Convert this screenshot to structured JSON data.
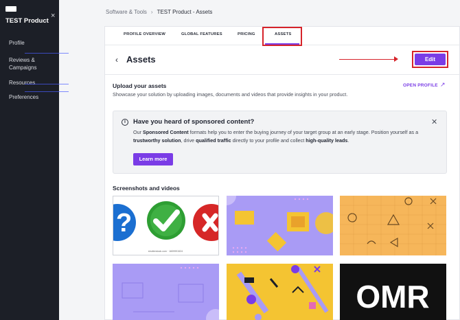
{
  "sidebar": {
    "product_name": "TEST Product",
    "items": [
      {
        "label": "Profile"
      },
      {
        "label": "Reviews & Campaigns"
      },
      {
        "label": "Resources"
      },
      {
        "label": "Preferences"
      }
    ]
  },
  "breadcrumb": {
    "parent": "Software & Tools",
    "separator": "›",
    "current": "TEST Product - Assets"
  },
  "tabs": [
    {
      "label": "PROFILE OVERVIEW"
    },
    {
      "label": "GLOBAL FEATURES"
    },
    {
      "label": "PRICING"
    },
    {
      "label": "ASSETS",
      "active": true
    }
  ],
  "header": {
    "back_icon": "‹",
    "title": "Assets",
    "edit_label": "Edit"
  },
  "upload": {
    "title": "Upload your assets",
    "description": "Showcase your solution by uploading images, documents and videos that provide insights in your product.",
    "open_profile_label": "OPEN PROFILE",
    "open_profile_icon": "↗"
  },
  "info_box": {
    "icon": "i",
    "title": "Have you heard of sponsored content?",
    "text_parts": {
      "p1": "Our ",
      "b1": "Sponsored Content",
      "p2": " formats help you to enter the buying journey of your target group at an early stage. Position yourself as a ",
      "b2": "trustworthy solution",
      "p3": ", drive ",
      "b3": "qualified traffic",
      "p4": " directly to your profile and collect ",
      "b4": "high-quality leads",
      "p5": "."
    },
    "button_label": "Learn more",
    "close_icon": "✕"
  },
  "media": {
    "title": "Screenshots and videos",
    "thumb1_caption": "shutterstock.com · 1609991524",
    "thumb6_logo": "OMR"
  },
  "colors": {
    "accent": "#7a3ce6",
    "annotation": "#d6232a",
    "sidebar_bg": "#1c1f27",
    "lavender": "#a99bf5",
    "yellow": "#f4c432",
    "orange": "#f6b65a"
  },
  "icons": {
    "close_sidebar": "×"
  }
}
